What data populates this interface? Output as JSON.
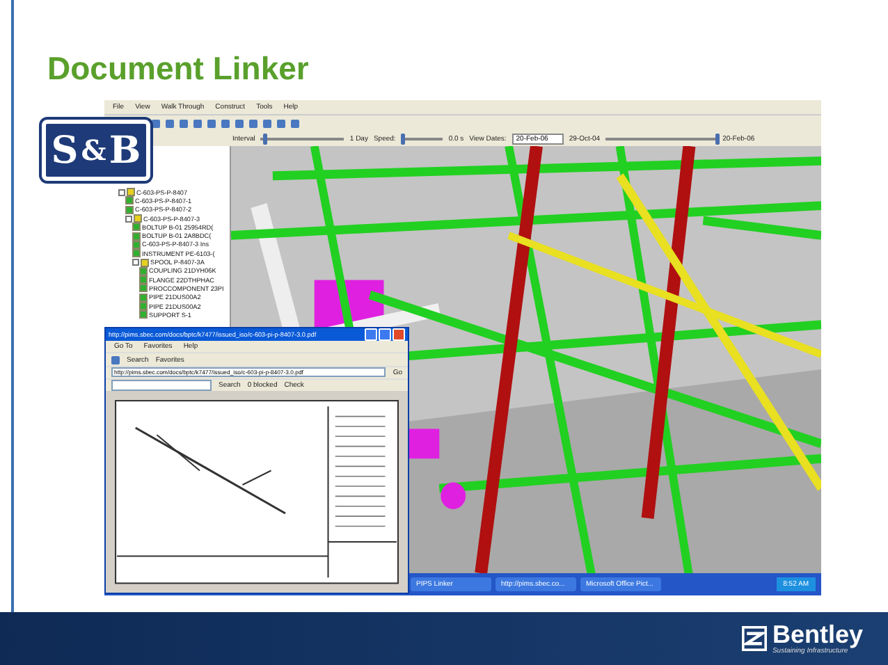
{
  "slide": {
    "title": "Document Linker"
  },
  "company_logo": {
    "letters": [
      "S",
      "&",
      "B"
    ]
  },
  "app": {
    "menu": [
      "File",
      "View",
      "Walk Through",
      "Construct",
      "Tools",
      "Help"
    ],
    "playback": {
      "interval_label": "Interval",
      "interval_slider": {
        "level": 0.05
      },
      "span": "1 Day",
      "speed_label": "Speed:",
      "speed_slider": {
        "level": 0.05
      },
      "speed_value": "0.0 s",
      "date_slider": {
        "level": 1
      },
      "view_dates_label": "View Dates:",
      "view_date": "20-Feb-06",
      "start_date": "29-Oct-04",
      "end_date": "20-Feb-06"
    },
    "tree": [
      {
        "label": "C-603-PS-P-8407",
        "children": [
          {
            "label": "C-603-PS-P-8407-1"
          },
          {
            "label": "C-603-PS-P-8407-2"
          },
          {
            "label": "C-603-PS-P-8407-3",
            "children": [
              {
                "label": "BOLTUP B-01 25954RD("
              },
              {
                "label": "BOLTUP B-01 2A8BDC("
              },
              {
                "label": "C-603-PS-P-8407-3 Ins"
              },
              {
                "label": "INSTRUMENT PE-6103-("
              },
              {
                "label": "SPOOL P-8407-3A",
                "children": [
                  {
                    "label": "COUPLING 21DYH06K"
                  },
                  {
                    "label": "FLANGE 22DTHPHAC"
                  },
                  {
                    "label": "PROCCOMPONENT 23PI"
                  },
                  {
                    "label": "PIPE 21DUS00A2"
                  },
                  {
                    "label": "PIPE 21DUS00A2"
                  },
                  {
                    "label": "SUPPORT S-1"
                  }
                ]
              }
            ]
          }
        ]
      }
    ]
  },
  "browser": {
    "title": "http://pims.sbec.com/docs/bptc/k7477/issued_iso/c-603-pi-p-8407-3.0.pdf",
    "menu": [
      "Go To",
      "Favorites",
      "Help"
    ],
    "toolbar": [
      "Search",
      "Favorites"
    ],
    "address": "http://pims.sbec.com/docs/bptc/k7477/issued_iso/c-603-pi-p-8407-3.0.pdf",
    "go": "Go",
    "toolbar2": [
      "Search",
      "0 blocked",
      "Check"
    ]
  },
  "taskbar": {
    "items": [
      "PIPS Linker",
      "http://pims.sbec.co...",
      "Microsoft Office Pict..."
    ],
    "time": "8:52 AM"
  },
  "footer": {
    "brand": "Bentley",
    "tagline": "Sustaining Infrastructure"
  }
}
